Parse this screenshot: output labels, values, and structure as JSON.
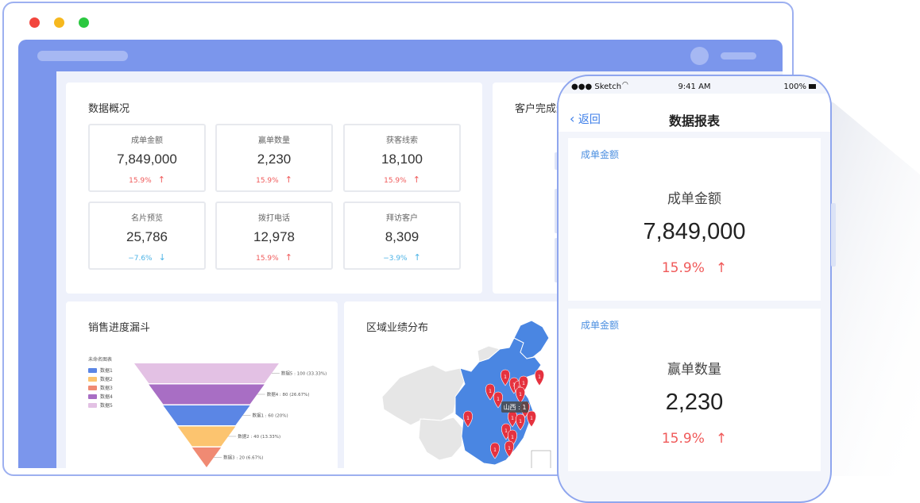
{
  "dashboard": {
    "overview": {
      "title": "数据概况",
      "stats": [
        {
          "label": "成单金额",
          "value": "7,849,000",
          "change": "15.9%",
          "arrow": "↑",
          "trend": "up"
        },
        {
          "label": "赢单数量",
          "value": "2,230",
          "change": "15.9%",
          "arrow": "↑",
          "trend": "up"
        },
        {
          "label": "获客线索",
          "value": "18,100",
          "change": "15.9%",
          "arrow": "↑",
          "trend": "up"
        },
        {
          "label": "名片预览",
          "value": "25,786",
          "change": "−7.6%",
          "arrow": "↓",
          "trend": "down"
        },
        {
          "label": "拨打电话",
          "value": "12,978",
          "change": "15.9%",
          "arrow": "↑",
          "trend": "up"
        },
        {
          "label": "拜访客户",
          "value": "8,309",
          "change": "−3.9%",
          "arrow": "↑",
          "trend": "down"
        }
      ]
    },
    "customer_card": {
      "title": "客户完成进"
    },
    "funnel": {
      "title": "销售进度漏斗",
      "legend_title": "未命名图表",
      "legend": [
        "数据1",
        "数据2",
        "数据3",
        "数据4",
        "数据5"
      ],
      "levels": [
        {
          "name": "数据5",
          "value": 100,
          "pct": "33.33%",
          "color": "#e3c1e4",
          "label": "数据5 : 100 (33.33%)"
        },
        {
          "name": "数据4",
          "value": 80,
          "pct": "26.67%",
          "color": "#a86ec4",
          "label": "数据4 : 80 (26.67%)"
        },
        {
          "name": "数据1",
          "value": 60,
          "pct": "20%",
          "color": "#5b86e5",
          "label": "数据1 : 60 (20%)"
        },
        {
          "name": "数据2",
          "value": 40,
          "pct": "13.33%",
          "color": "#fcc46f",
          "label": "数据2 : 40 (13.33%)"
        },
        {
          "name": "数据3",
          "value": 20,
          "pct": "6.67%",
          "color": "#f08a73",
          "label": "数据3 : 20 (6.67%)"
        }
      ],
      "legend_colors": [
        "#5b86e5",
        "#fcc46f",
        "#f08a73",
        "#a86ec4",
        "#e3c1e4"
      ]
    },
    "region": {
      "title": "区域业绩分布",
      "tooltip": "山西 : 1",
      "pin_label": "1"
    }
  },
  "phone": {
    "carrier": "●●● Sketch",
    "time": "9:41 AM",
    "battery": "100%",
    "back_label": "返回",
    "title": "数据报表",
    "cards": [
      {
        "section": "成单金额",
        "label": "成单金额",
        "value": "7,849,000",
        "change": "15.9%",
        "arrow": "↑"
      },
      {
        "section": "成单金额",
        "label": "赢单数量",
        "value": "2,230",
        "change": "15.9%",
        "arrow": "↑"
      }
    ]
  },
  "colors": {
    "accent": "#7b96ec",
    "up": "#f05a5a",
    "down": "#4cb3e6",
    "link": "#3b7de9"
  }
}
